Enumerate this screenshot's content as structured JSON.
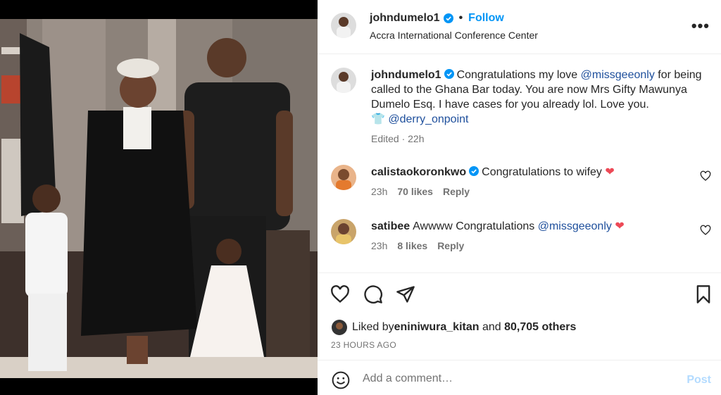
{
  "post": {
    "author": "johndumelo1",
    "follow_label": "Follow",
    "location": "Accra International Conference Center",
    "more_label": "•••"
  },
  "caption": {
    "username": "johndumelo1",
    "text_1": "Congratulations my love ",
    "mention_1": "@missgeeonly",
    "text_2": " for being called to the Ghana Bar today. You are now Mrs Gifty Mawunya Dumelo Esq. I have cases for you already lol. Love you.",
    "shirt_emoji": "👕",
    "mention_2": "@derry_onpoint",
    "edited": "Edited · 22h"
  },
  "comments": [
    {
      "username": "calistaokoronkwo",
      "verified": true,
      "text": "Congratulations to wifey ",
      "emoji": "❤",
      "time": "23h",
      "likes": "70 likes",
      "reply": "Reply"
    },
    {
      "username": "satibee",
      "verified": false,
      "text": "Awwww Congratulations ",
      "mention": "@missgeeonly",
      "emoji": "❤",
      "time": "23h",
      "likes": "8 likes",
      "reply": "Reply"
    }
  ],
  "likes_line": {
    "prefix": "Liked by ",
    "user": "eniniwura_kitan",
    "middle": " and ",
    "count": "80,705 others"
  },
  "timestamp": "23 HOURS AGO",
  "add_comment": {
    "placeholder": "Add a comment…",
    "post_label": "Post"
  },
  "colors": {
    "follow_blue": "#0095f6",
    "verified_blue": "#0095f6",
    "mention_blue": "#1e4f9c",
    "heart_red": "#ed4956",
    "post_disabled": "#b3dbff"
  },
  "icons": [
    "verified-badge-icon",
    "more-options-icon",
    "heart-icon",
    "comment-icon",
    "share-icon",
    "bookmark-icon",
    "emoji-icon"
  ]
}
